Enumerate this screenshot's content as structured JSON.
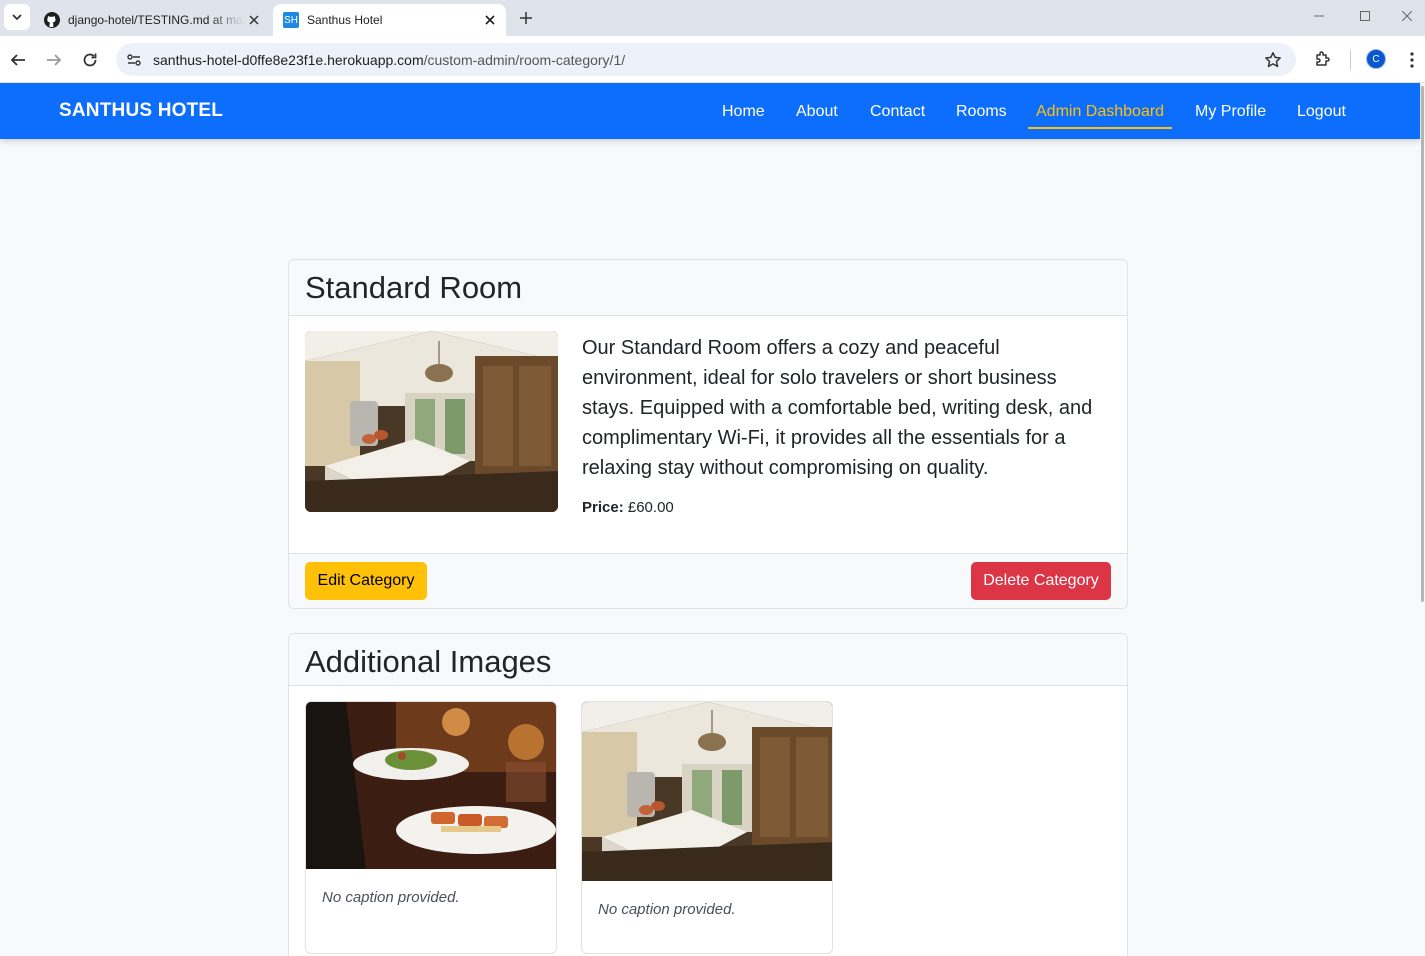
{
  "browser": {
    "tabs": [
      {
        "title": "django-hotel/TESTING.md at main · CharitaN1/django-hotel",
        "icon": "github-icon",
        "active": false
      },
      {
        "title": "Santhus Hotel",
        "icon": "sh-favicon",
        "favicon_text": "SH",
        "active": true
      }
    ],
    "url_host": "santhus-hotel-d0ffe8e23f1e.herokuapp.com",
    "url_path": "/custom-admin/room-category/1/",
    "profile_initial": "C"
  },
  "nav": {
    "brand": "SANTHUS HOTEL",
    "links": [
      "Home",
      "About",
      "Contact",
      "Rooms",
      "Admin Dashboard",
      "My Profile",
      "Logout"
    ],
    "active_link": "Admin Dashboard"
  },
  "room": {
    "title": "Standard Room",
    "description": "Our Standard Room offers a cozy and peaceful environment, ideal for solo travelers or short business stays. Equipped with a comfortable bed, writing desk, and complimentary Wi-Fi, it provides all the essentials for a relaxing stay without compromising on quality.",
    "price_label": "Price:",
    "price_value": "£60.00",
    "edit_label": "Edit Category",
    "delete_label": "Delete Category"
  },
  "additional": {
    "title": "Additional Images",
    "images": [
      {
        "caption": "No caption provided.",
        "subject": "restaurant-plates"
      },
      {
        "caption": "No caption provided.",
        "subject": "bedroom"
      }
    ]
  },
  "colors": {
    "primary": "#0d6efd",
    "warning": "#ffc107",
    "danger": "#dc3545"
  }
}
